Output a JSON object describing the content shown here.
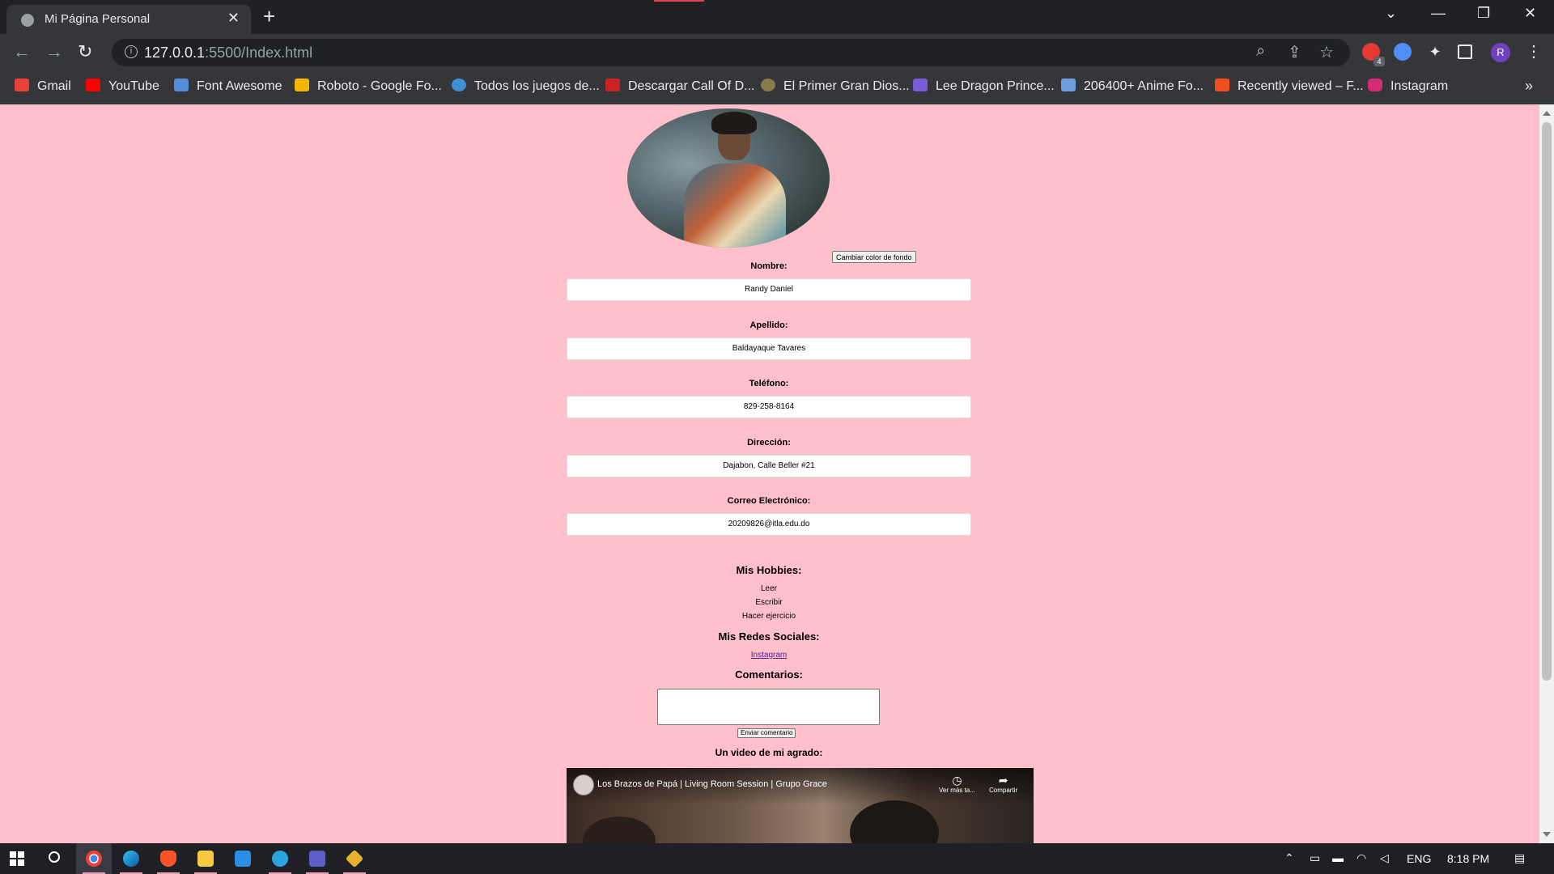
{
  "browser": {
    "tab_title": "Mi Página Personal",
    "tab_close": "✕",
    "new_tab": "+",
    "window_controls": {
      "dropdown": "⌄",
      "minimize": "—",
      "restore": "❐",
      "close": "✕"
    },
    "nav": {
      "back": "←",
      "forward": "→",
      "reload": "↻"
    },
    "url": {
      "host": "127.0.0.1",
      "rest": ":5500/Index.html"
    },
    "omnibox_icons": {
      "zoom": "⌕",
      "share": "⇪",
      "star": "☆"
    },
    "extension_badge": "4",
    "profile_initial": "R",
    "menu": "⋮",
    "bookmarks": [
      {
        "label": "Gmail",
        "icon_color": "#ea4335"
      },
      {
        "label": "YouTube",
        "icon_color": "#ff0000"
      },
      {
        "label": "Font Awesome",
        "icon_color": "#538dd7"
      },
      {
        "label": "Roboto - Google Fo...",
        "icon_color": "#f4b400"
      },
      {
        "label": "Todos los juegos de...",
        "icon_color": "#3d8fd6"
      },
      {
        "label": "Descargar Call Of D...",
        "icon_color": "#cc2222"
      },
      {
        "label": "El Primer Gran Dios...",
        "icon_color": "#8a7a4a"
      },
      {
        "label": "Lee Dragon Prince...",
        "icon_color": "#7b5cd6"
      },
      {
        "label": "206400+ Anime Fo...",
        "icon_color": "#6aa0e0"
      },
      {
        "label": "Recently viewed – F...",
        "icon_color": "#f24e1e"
      },
      {
        "label": "Instagram",
        "icon_color": "#d62976"
      }
    ],
    "bookmarks_more": "»"
  },
  "page": {
    "background_color": "#ffc0cb",
    "bg_button_label": "Cambiar color de fondo",
    "fields": [
      {
        "label": "Nombre:",
        "value": "Randy Daniel"
      },
      {
        "label": "Apellido:",
        "value": "Baldayaque Tavares"
      },
      {
        "label": "Teléfono:",
        "value": "829-258-8164"
      },
      {
        "label": "Dirección:",
        "value": "Dajabon, Calle Beller #21"
      },
      {
        "label": "Correo Electrónico:",
        "value": "20209826@itla.edu.do"
      }
    ],
    "hobbies_title": "Mis Hobbies:",
    "hobbies": [
      "Leer",
      "Escribir",
      "Hacer ejercicio"
    ],
    "social_title": "Mis Redes Sociales:",
    "social_link": "Instagram",
    "comments_title": "Comentarios:",
    "comment_value": "",
    "send_button_label": "Enviar comentario",
    "video_title": "Un video de mi agrado:",
    "video": {
      "title": "Los Brazos de Papá | Living Room Session | Grupo Grace",
      "watch_later": "Ver más ta...",
      "share": "Compartir"
    }
  },
  "taskbar": {
    "tray_language": "ENG",
    "time": "8:18 PM"
  }
}
